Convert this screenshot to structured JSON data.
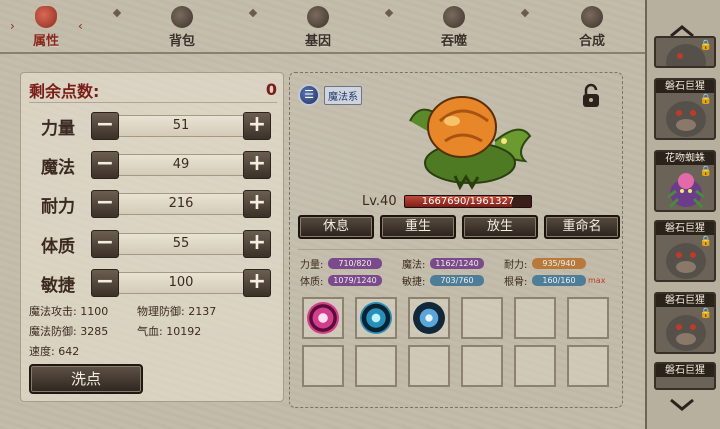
{
  "tabs": [
    {
      "label": "属性",
      "icon": "flame-icon",
      "active": true
    },
    {
      "label": "背包",
      "icon": "bag-icon",
      "active": false
    },
    {
      "label": "基因",
      "icon": "dna-icon",
      "active": false
    },
    {
      "label": "吞噬",
      "icon": "devour-icon",
      "active": false
    },
    {
      "label": "合成",
      "icon": "synthesis-icon",
      "active": false
    }
  ],
  "points": {
    "label": "剩余点数:",
    "value": "0"
  },
  "stats": [
    {
      "name": "力量",
      "value": "51"
    },
    {
      "name": "魔法",
      "value": "49"
    },
    {
      "name": "耐力",
      "value": "216"
    },
    {
      "name": "体质",
      "value": "55"
    },
    {
      "name": "敏捷",
      "value": "100"
    }
  ],
  "derived": {
    "magic_attack": "魔法攻击: 1100",
    "phys_defense": "物理防御: 2137",
    "magic_defense": "魔法防御: 3285",
    "hp": "气血: 10192",
    "speed": "速度: 642"
  },
  "reset_label": "洗点",
  "pet": {
    "type_label": "魔法系",
    "level": "Lv.40",
    "hp_text": "1667690/1961327",
    "hp_ratio": 0.85
  },
  "actions": [
    "休息",
    "重生",
    "放生",
    "重命名"
  ],
  "attributes": [
    {
      "name": "力量:",
      "value": "710/820",
      "color": "#7b4a8a"
    },
    {
      "name": "魔法:",
      "value": "1162/1240",
      "color": "#7b4a8a"
    },
    {
      "name": "耐力:",
      "value": "935/940",
      "color": "#b77a3a"
    },
    {
      "name": "体质:",
      "value": "1079/1240",
      "color": "#7b4a8a"
    },
    {
      "name": "敏捷:",
      "value": "703/760",
      "color": "#4e7d98"
    },
    {
      "name": "根骨:",
      "value": "160/160",
      "color": "#4e7d98"
    }
  ],
  "max_label": "max",
  "skills": [
    {
      "icon": "vortex-skill-icon",
      "color": "#d23e8a"
    },
    {
      "icon": "orb-skill-icon",
      "color": "#2a8fb8"
    },
    {
      "icon": "crystal-skill-icon",
      "color": "#5aa6d8"
    }
  ],
  "sidebar": [
    {
      "name": "",
      "kind": "golem"
    },
    {
      "name": "磐石巨猩",
      "kind": "golem"
    },
    {
      "name": "花吻蜘蛛",
      "kind": "spider"
    },
    {
      "name": "磐石巨猩",
      "kind": "golem"
    },
    {
      "name": "磐石巨猩",
      "kind": "golem"
    },
    {
      "name": "磐石巨猩",
      "kind": "golem"
    }
  ]
}
